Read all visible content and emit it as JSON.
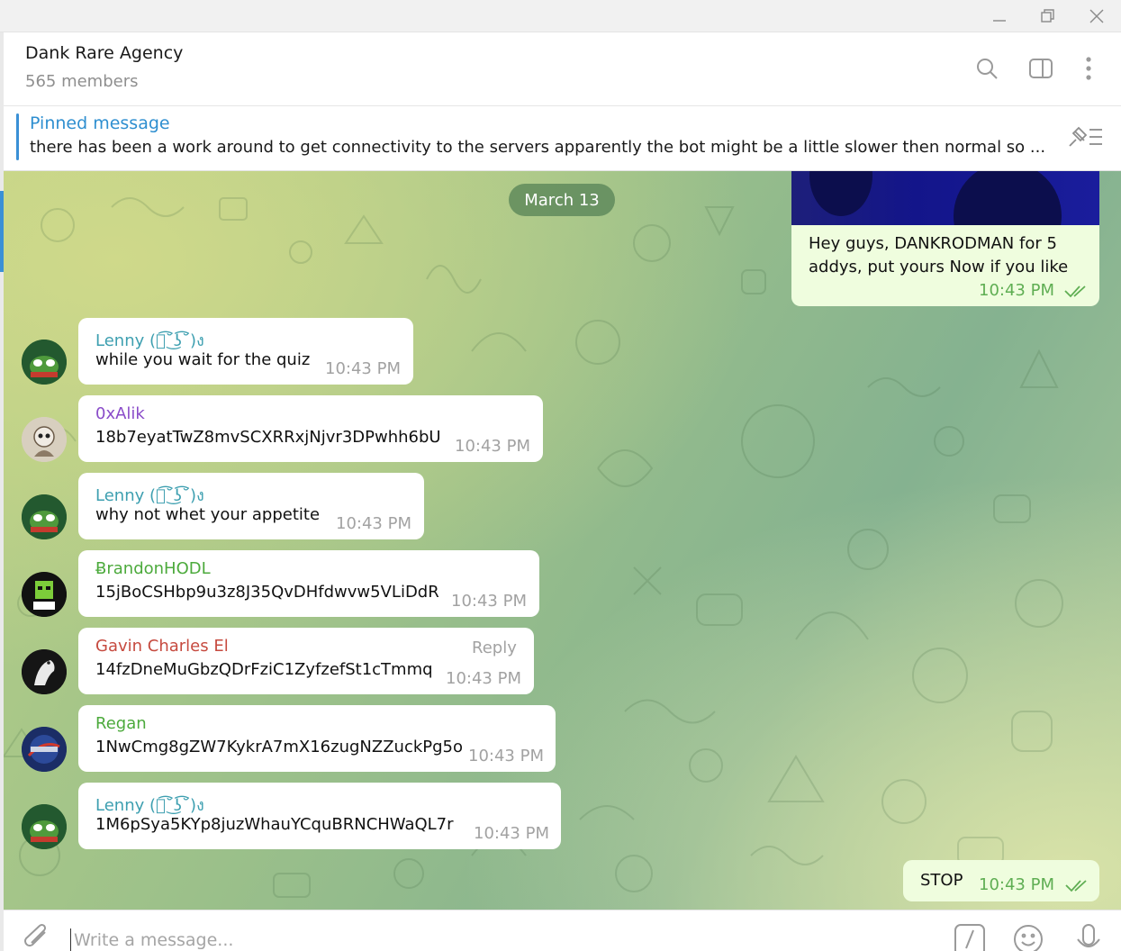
{
  "header": {
    "title": "Dank Rare Agency",
    "subtitle": "565 members"
  },
  "pinned": {
    "title": "Pinned message",
    "text": "there has been a work around to get connectivity to the servers apparently the bot might be a little slower then normal so ..."
  },
  "date_separator": "March 13",
  "outgoing": [
    {
      "text_line1": "Hey guys, DANKRODMAN for 5",
      "text_line2": "addys, put yours Now if you like",
      "time": "10:43 PM"
    },
    {
      "text": "STOP",
      "time": "10:43 PM"
    }
  ],
  "messages": [
    {
      "sender": "Lenny (ง͡˘͜ʖ͡˘)ง",
      "sender_color": "#3d9fb0",
      "text": "while you wait for the quiz",
      "time": "10:43 PM"
    },
    {
      "sender": "0xAlik",
      "sender_color": "#8a4cc9",
      "text": "18b7eyatTwZ8mvSCXRRxjNjvr3DPwhh6bU",
      "time": "10:43 PM"
    },
    {
      "sender": "Lenny (ง͡˘͜ʖ͡˘)ง",
      "sender_color": "#3d9fb0",
      "text": "why not whet your appetite",
      "time": "10:43 PM"
    },
    {
      "sender": "ɃrandonHODL",
      "sender_color": "#4caa3c",
      "text": "15jBoCSHbp9u3z8J35QvDHfdwvw5VLiDdR",
      "time": "10:43 PM"
    },
    {
      "sender": "Gavin Charles El",
      "sender_color": "#c64a3f",
      "text": "14fzDneMuGbzQDrFziC1ZyfzefSt1cTmmq",
      "time": "10:43 PM",
      "reply": "Reply"
    },
    {
      "sender": "Regan",
      "sender_color": "#4caa3c",
      "text": "1NwCmg8gZW7KykrA7mX16zugNZZuckPg5o",
      "time": "10:43 PM"
    },
    {
      "sender": "Lenny (ง͡˘͜ʖ͡˘)ง",
      "sender_color": "#3d9fb0",
      "text": "1M6pSya5KYp8juzWhauYCquBRNCHWaQL7r",
      "time": "10:43 PM"
    }
  ],
  "composer": {
    "placeholder": "Write a message..."
  },
  "icons": {
    "minimize": "minimize-icon",
    "restore": "restore-icon",
    "close": "close-icon",
    "search": "search-icon",
    "sidebar": "sidebar-toggle-icon",
    "more": "more-vertical-icon",
    "unpin": "unpin-icon",
    "attach": "paperclip-icon",
    "commands": "slash-commands-icon",
    "emoji": "emoji-icon",
    "mic": "microphone-icon",
    "read": "double-check-icon"
  },
  "colors": {
    "accent": "#3a90d6",
    "outgoing_bubble": "#effdde",
    "outgoing_time": "#5fae53"
  }
}
